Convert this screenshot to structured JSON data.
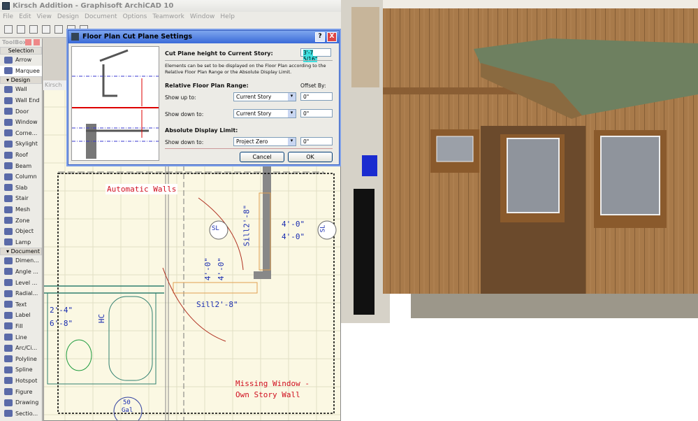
{
  "window": {
    "title": "Kirsch Addition - Graphisoft ArchiCAD 10"
  },
  "menu": [
    "File",
    "Edit",
    "View",
    "Design",
    "Document",
    "Options",
    "Teamwork",
    "Window",
    "Help"
  ],
  "toolbox": {
    "title": "ToolBox",
    "selection": "Selection",
    "selection_items": [
      "Arrow",
      "Marquee"
    ],
    "design_header": "Design",
    "design_items": [
      "Wall",
      "Wall End",
      "Door",
      "Window",
      "Corne...",
      "Skylight",
      "Roof",
      "Beam",
      "Column",
      "Slab",
      "Stair",
      "Mesh",
      "Zone",
      "Object",
      "Lamp"
    ],
    "document_header": "Document",
    "document_items": [
      "Dimen...",
      "Angle ...",
      "Level ...",
      "Radial...",
      "Text",
      "Label",
      "Fill",
      "Line",
      "Arc/Ci...",
      "Polyline",
      "Spline",
      "Hotspot",
      "Figure",
      "Drawing",
      "Sectio..."
    ]
  },
  "plan": {
    "tab": "Kirsch",
    "annotations": [
      "Automatic Walls",
      "Missing Window -",
      "Own Story Wall"
    ],
    "dims": {
      "sl1": "SL",
      "sl2": "SL",
      "w1a": "4'-0\"",
      "w1b": "4'-0\"",
      "w2a": "4'-0\"",
      "w2b": "4'-0\"",
      "sill1": "Sill2'-8\"",
      "sill2": "Sill2'-8\"",
      "d1": "2'-4\"",
      "d2": "6'-8\"",
      "hc": "HC",
      "tank1": "50",
      "tank2": "Gal"
    }
  },
  "dialog": {
    "title": "Floor Plan Cut Plane Settings",
    "help": "?",
    "close": "X",
    "cut_plane_label": "Cut Plane height to Current Story:",
    "cut_plane_value": "3'-7 5/16\"",
    "description": "Elements can be set to be displayed on the Floor Plan according to the Relative Floor Plan Range or the Absolute Display Limit.",
    "relative_header": "Relative Floor Plan Range:",
    "offset_header": "Offset By:",
    "show_up_label": "Show up to:",
    "show_up_value": "Current Story",
    "show_up_offset": "0\"",
    "show_down_label": "Show down to:",
    "show_down_value": "Current Story",
    "show_down_offset": "0\"",
    "absolute_header": "Absolute Display Limit:",
    "abs_down_label": "Show down to:",
    "abs_down_value": "Project Zero",
    "abs_down_offset": "0\"",
    "cancel": "Cancel",
    "ok": "OK"
  }
}
